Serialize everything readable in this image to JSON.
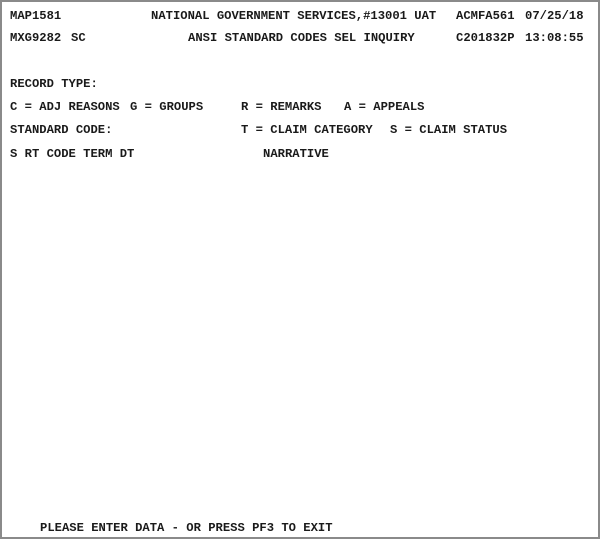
{
  "header": {
    "map_id": "MAP1581",
    "org_title": "NATIONAL GOVERNMENT SERVICES,#13001 UAT",
    "terminal_id": "ACMFA561",
    "date": "07/25/18",
    "screen_id": "MXG9282",
    "function_code": "SC",
    "screen_title": "ANSI STANDARD CODES SEL INQUIRY",
    "user_id": "C201832P",
    "time": "13:08:55"
  },
  "form": {
    "record_type_label": "RECORD TYPE:",
    "record_type_value": "",
    "options_row1": {
      "c": "C = ADJ REASONS",
      "g": "G = GROUPS",
      "r": "R = REMARKS",
      "a": "A = APPEALS"
    },
    "standard_code_label": "STANDARD CODE:",
    "standard_code_value": "",
    "options_row2": {
      "t": "T = CLAIM CATEGORY",
      "s": "S = CLAIM STATUS"
    }
  },
  "results": {
    "columns_left": "S RT CODE TERM DT",
    "column_narrative": "NARRATIVE",
    "rows": []
  },
  "footer": {
    "message": "PLEASE ENTER DATA - OR PRESS PF3 TO EXIT"
  }
}
